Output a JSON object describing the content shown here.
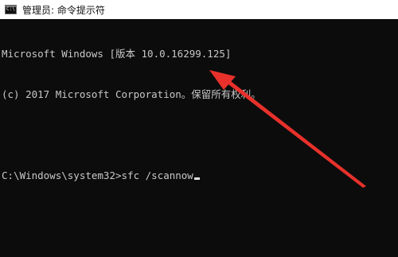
{
  "titlebar": {
    "icon": "cmd-console-icon",
    "icon_glyph": "C:\\",
    "title": "管理员: 命令提示符"
  },
  "console": {
    "lines": [
      "Microsoft Windows [版本 10.0.16299.125]",
      "(c) 2017 Microsoft Corporation。保留所有权利。",
      "",
      "C:\\Windows\\system32>sfc /scannow"
    ]
  },
  "annotation": {
    "icon": "red-arrow-icon",
    "color": "#e8312b"
  }
}
